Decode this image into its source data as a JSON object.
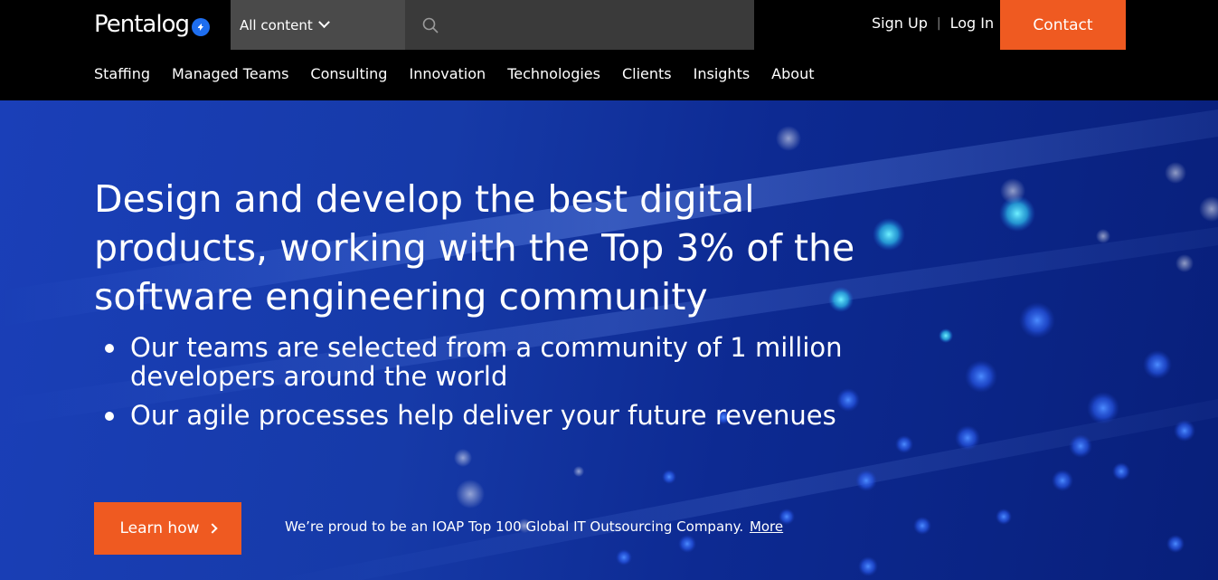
{
  "brand": {
    "name": "Pentalog",
    "accent": "#ef5a21",
    "badge_color": "#1e6ef0"
  },
  "search": {
    "scope_label": "All content",
    "placeholder": "",
    "value": ""
  },
  "auth": {
    "sign_up": "Sign Up",
    "separator": "|",
    "log_in": "Log In"
  },
  "header": {
    "contact_label": "Contact"
  },
  "nav": {
    "items": [
      {
        "label": "Staffing"
      },
      {
        "label": "Managed Teams"
      },
      {
        "label": "Consulting"
      },
      {
        "label": "Innovation"
      },
      {
        "label": "Technologies"
      },
      {
        "label": "Clients"
      },
      {
        "label": "Insights"
      },
      {
        "label": "About"
      }
    ]
  },
  "hero": {
    "headline": "Design and develop the best digital products, working with the Top 3% of the software engineering community",
    "bullets": [
      "Our teams are selected from a community of 1 million developers around the world",
      "Our agile processes help deliver your future revenues"
    ],
    "cta_label": "Learn how",
    "award_text": "We’re proud to be an IOAP Top 100 Global IT Outsourcing Company.",
    "award_link": "More"
  },
  "icons": {
    "search": "search-icon",
    "dropdown": "chevron-down-icon",
    "cta_arrow": "chevron-right-icon",
    "logo_badge": "logo-badge-icon"
  }
}
